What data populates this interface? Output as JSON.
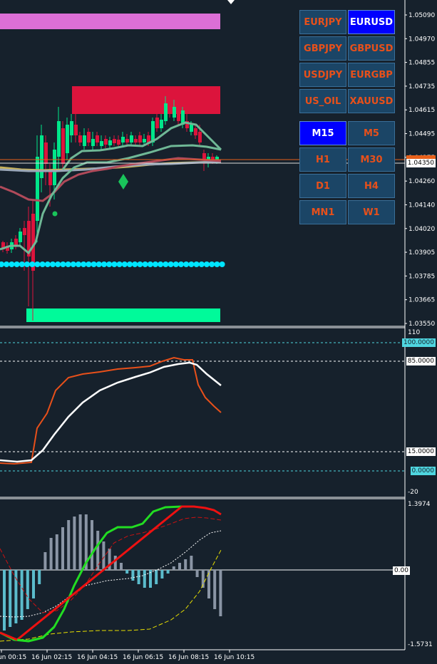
{
  "symbol_buttons": [
    {
      "label": "EURJPY",
      "active": false
    },
    {
      "label": "EURUSD",
      "active": true
    },
    {
      "label": "GBPJPY",
      "active": false
    },
    {
      "label": "GBPUSD",
      "active": false
    },
    {
      "label": "USDJPY",
      "active": false
    },
    {
      "label": "EURGBP",
      "active": false
    },
    {
      "label": "US_OIL",
      "active": false
    },
    {
      "label": "XAUUSD",
      "active": false
    }
  ],
  "timeframe_buttons": [
    {
      "label": "M15",
      "active": true
    },
    {
      "label": "M5",
      "active": false
    },
    {
      "label": "H1",
      "active": false
    },
    {
      "label": "M30",
      "active": false
    },
    {
      "label": "D1",
      "active": false
    },
    {
      "label": "H4",
      "active": false
    },
    {
      "label": "MN1",
      "active": false
    },
    {
      "label": "W1",
      "active": false
    }
  ],
  "price_axis": [
    "1.05090",
    "1.04970",
    "1.04855",
    "1.04735",
    "1.04615",
    "1.04495",
    "1.04375",
    "1.04260",
    "1.04140",
    "1.04020",
    "1.03905",
    "1.03785",
    "1.03665",
    "1.03550"
  ],
  "price_tags": {
    "ask": "1.04378",
    "bid": "1.04350"
  },
  "stoch_axis": {
    "top": "110",
    "bottom": "-20"
  },
  "stoch_levels": [
    "100.0000",
    "85.0000",
    "15.0000",
    "0.0000"
  ],
  "macd_axis": {
    "top": "1.3974",
    "zero": "0.00",
    "bottom": "-1.5731"
  },
  "time_labels": [
    "16 Jun 00:15",
    "16 Jun 02:15",
    "16 Jun 04:15",
    "16 Jun 06:15",
    "16 Jun 08:15",
    "16 Jun 10:15"
  ],
  "colors": {
    "background": "#16212c",
    "bull_candle": "#00e68a",
    "bear_candle": "#dc143c",
    "zone_top": "#dc6fd6",
    "zone_red": "#dc143c",
    "zone_green": "#00fa9a",
    "dots": "#00e5ff",
    "button_bg": "#1b4566",
    "button_active": "#0000ff",
    "button_text": "#e8501a"
  }
}
